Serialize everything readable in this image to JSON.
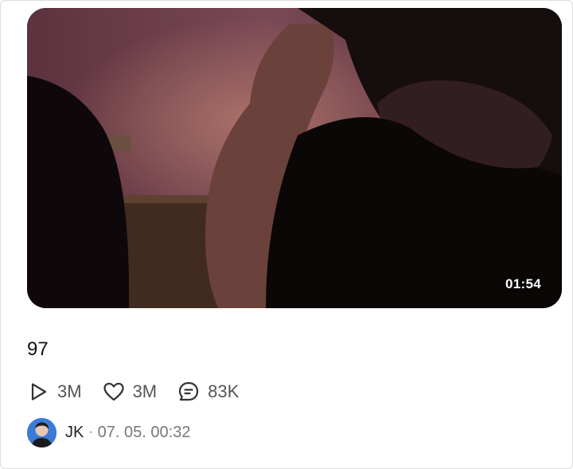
{
  "post": {
    "title": "97",
    "duration": "01:54",
    "stats": {
      "plays": "3M",
      "likes": "3M",
      "comments": "83K"
    },
    "author": "JK",
    "separator": "·",
    "date": "07. 05. 00:32"
  },
  "icons": {
    "plays": "play-icon",
    "likes": "heart-icon",
    "comments": "comment-icon"
  },
  "colors": {
    "text": "#111111",
    "muted": "#555555",
    "date": "#777777"
  }
}
